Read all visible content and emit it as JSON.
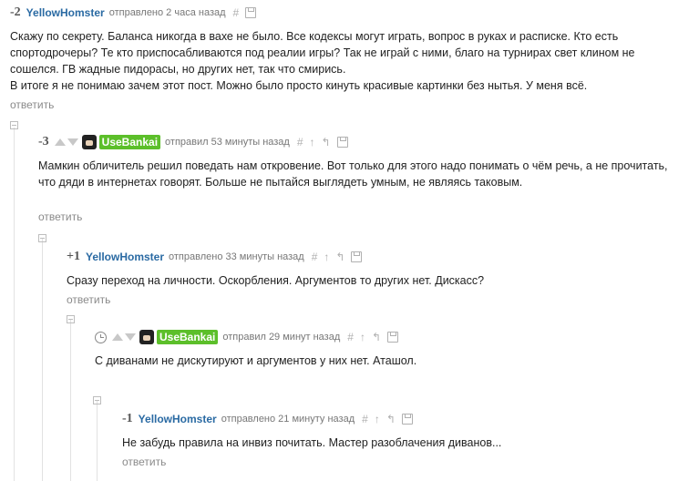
{
  "comments": [
    {
      "rating": "-2",
      "user": "YellowHomster",
      "meta": "отправлено 2 часа назад",
      "body": [
        "Скажу по секрету. Баланса никогда в вахе не было. Все кодексы могут играть, вопрос в руках и расписке. Кто есть",
        "спортодрочеры? Те кто приспосабливаются под реалии игры? Так не играй с ними, благо на турнирах свет клином не",
        "сошелся. ГВ жадные пидорасы, но других нет, так что смирись.",
        "В итоге я не понимаю зачем этот пост. Можно было просто кинуть красивые картинки без нытья. У меня всё."
      ],
      "reply": "ответить"
    },
    {
      "rating": "-3",
      "user": "UseBankai",
      "meta": "отправил 53 минуты назад",
      "body": [
        "Мамкин обличитель решил поведать нам откровение. Вот только для этого надо понимать о  чём речь, а не прочитать,",
        "что дяди в интернетах говорят.  Больше не пытайся выглядеть умным, не являясь таковым."
      ],
      "reply": "ответить"
    },
    {
      "rating": "+1",
      "user": "YellowHomster",
      "meta": "отправлено 33 минуты назад",
      "body": [
        "Сразу переход на личности. Оскорбления. Аргументов то других нет. Дискасс?"
      ],
      "reply": "ответить"
    },
    {
      "rating": "",
      "user": "UseBankai",
      "meta": "отправил 29 минут назад",
      "body": [
        "С диванами не дискутируют и аргументов у них нет.  Аташол."
      ],
      "reply": ""
    },
    {
      "rating": "-1",
      "user": "YellowHomster",
      "meta": "отправлено 21 минуту назад",
      "body": [
        "Не забудь правила на инвиз почитать. Мастер разоблачения диванов..."
      ],
      "reply": "ответить"
    }
  ],
  "icons": {
    "hash": "#",
    "up": "↑",
    "parent": "↰"
  },
  "colors": {
    "username": "#2a6aa3",
    "badge_bg": "#5cbf2a",
    "reply": "#8a8a8a"
  }
}
